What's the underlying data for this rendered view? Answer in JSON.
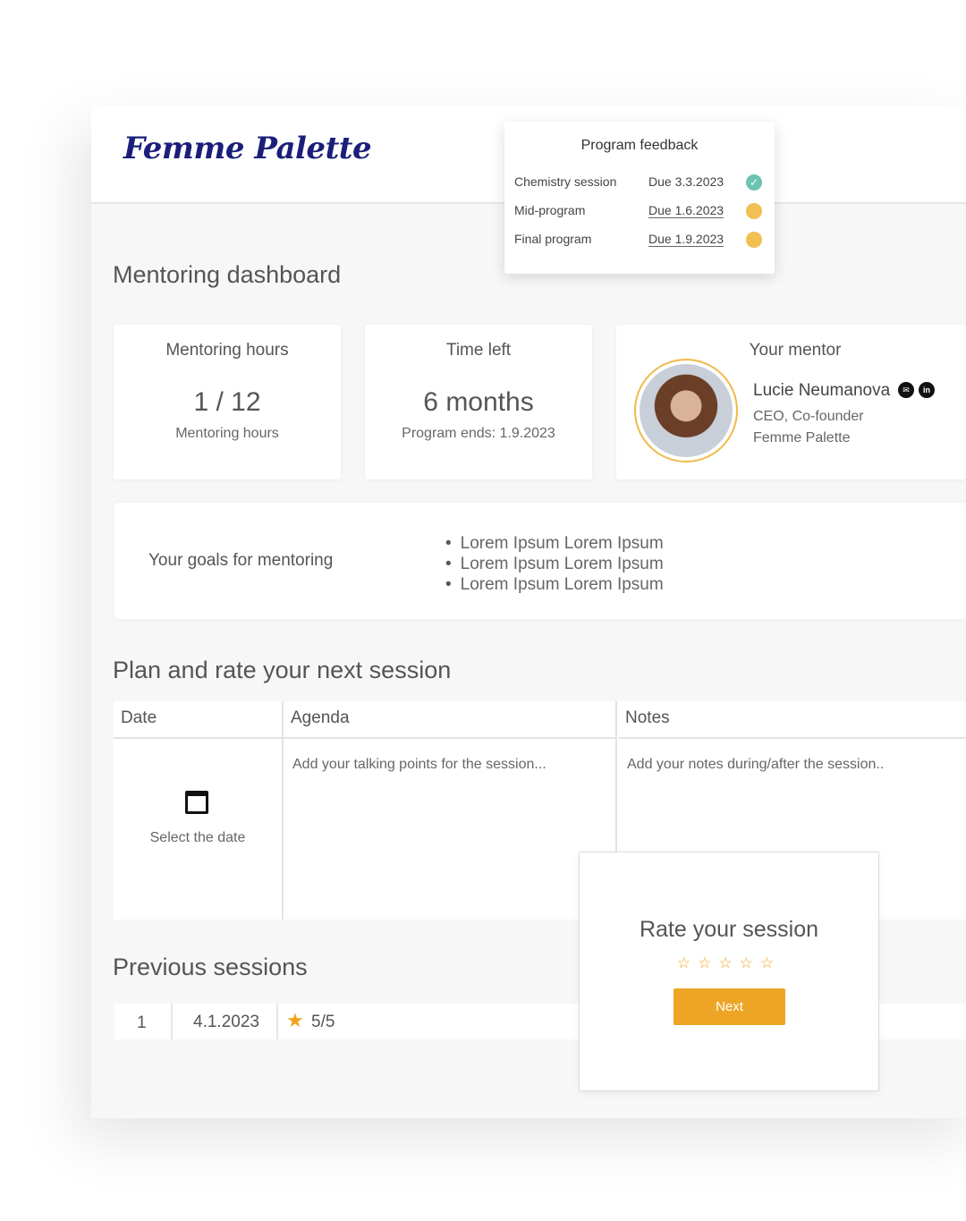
{
  "brand": {
    "logo_text": "Femme Palette"
  },
  "feedback": {
    "title": "Program feedback",
    "items": [
      {
        "name": "Chemistry session",
        "due": "Due 3.3.2023",
        "status": "done"
      },
      {
        "name": "Mid-program",
        "due": "Due 1.6.2023",
        "status": "pending"
      },
      {
        "name": "Final program",
        "due": "Due 1.9.2023",
        "status": "pending"
      }
    ],
    "done_glyph": "✓"
  },
  "dashboard": {
    "title": "Mentoring dashboard"
  },
  "cards": {
    "hours": {
      "title": "Mentoring hours",
      "value": "1 / 12",
      "sub": "Mentoring hours"
    },
    "time": {
      "title": "Time left",
      "value": "6 months",
      "sub": "Program ends: 1.9.2023"
    },
    "mentor": {
      "title": "Your mentor",
      "name": "Lucie Neumanova",
      "role": "CEO, Co-founder",
      "company": "Femme Palette",
      "mail_glyph": "✉",
      "linkedin_glyph": "in"
    }
  },
  "goals": {
    "label": "Your goals for mentoring",
    "items": [
      "Lorem Ipsum Lorem Ipsum",
      "Lorem Ipsum Lorem Ipsum",
      "Lorem Ipsum Lorem Ipsum"
    ]
  },
  "plan": {
    "title": "Plan and rate your next session",
    "columns": [
      "Date",
      "Agenda",
      "Notes"
    ],
    "select_date": "Select the date",
    "agenda_placeholder": "Add your talking points for the session...",
    "notes_placeholder": "Add your notes during/after the session.."
  },
  "previous": {
    "title": "Previous sessions",
    "rows": [
      {
        "index": "1",
        "date": "4.1.2023",
        "rating": "5/5"
      }
    ],
    "star_glyph": "★"
  },
  "rate": {
    "title": "Rate your session",
    "stars": "☆☆☆☆☆",
    "next_label": "Next"
  },
  "colors": {
    "accent": "#eea526",
    "brand": "#1b1f7a",
    "done": "#6cc3b4",
    "pending": "#f1bf52"
  }
}
